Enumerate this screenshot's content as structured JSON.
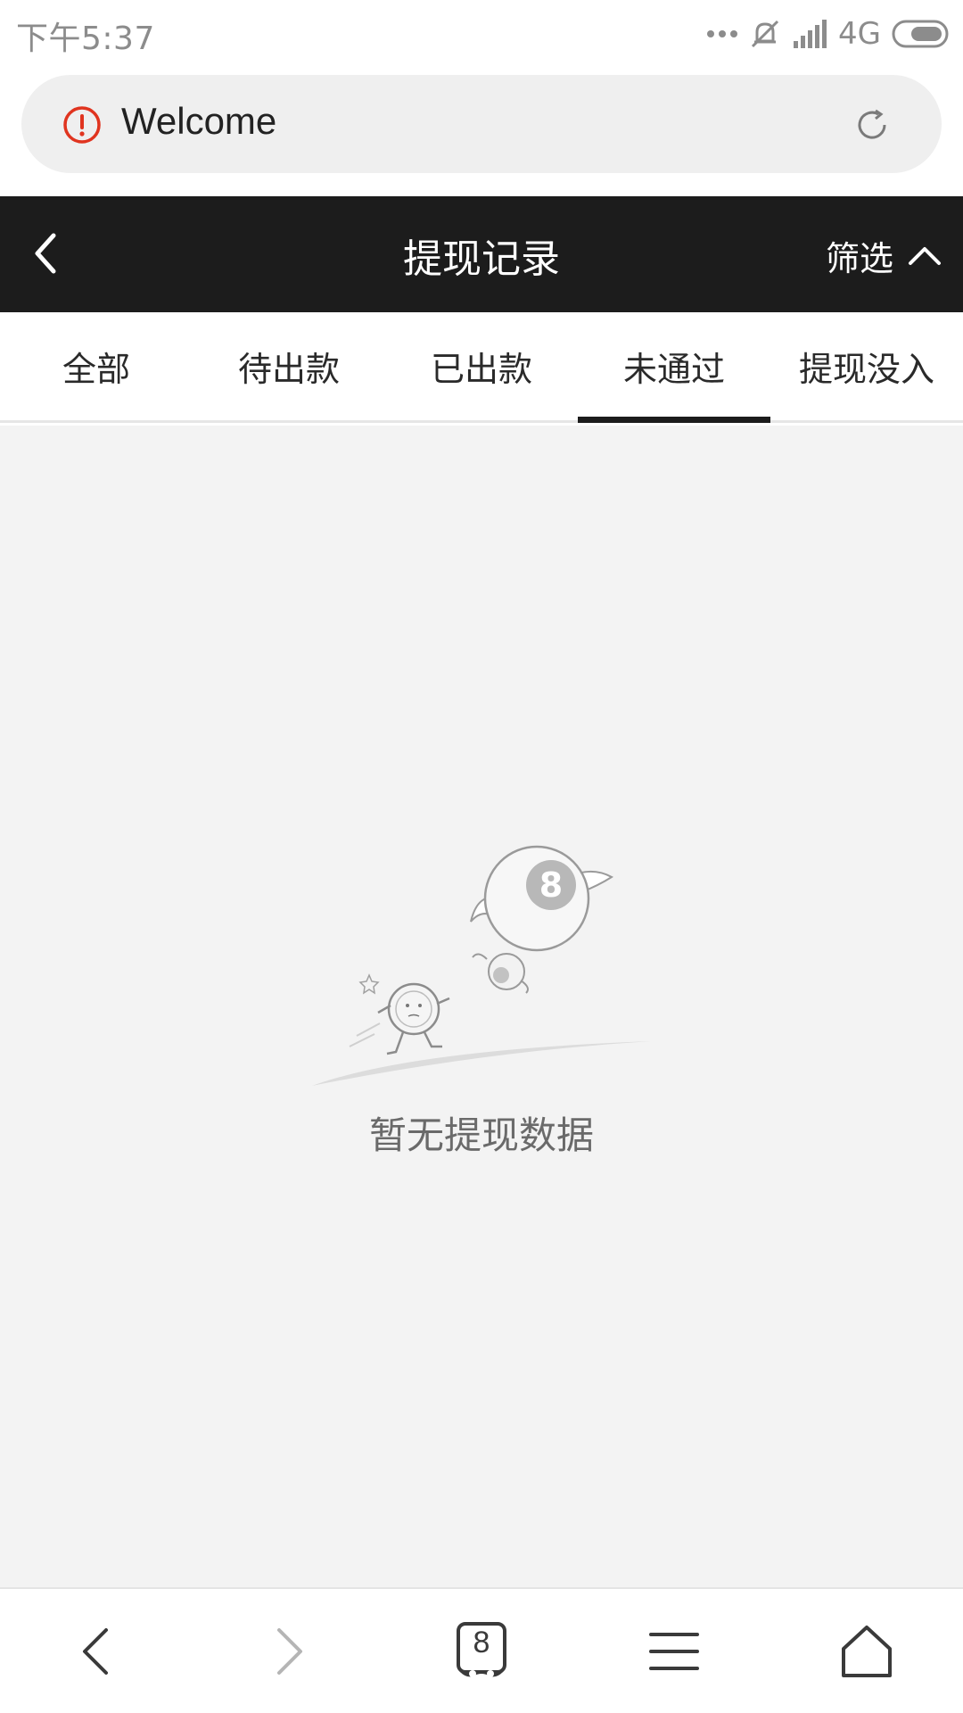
{
  "status_bar": {
    "time": "下午5:37",
    "network": "4G"
  },
  "browser": {
    "page_title": "Welcome",
    "icons": {
      "warning": "warning-circle-icon",
      "reload": "reload-icon"
    },
    "warning_color": "#e0341f"
  },
  "header": {
    "title": "提现记录",
    "filter_label": "筛选",
    "background": "#1c1c1c"
  },
  "tabs": [
    {
      "label": "全部",
      "active": false
    },
    {
      "label": "待出款",
      "active": false
    },
    {
      "label": "已出款",
      "active": false
    },
    {
      "label": "未通过",
      "active": true
    },
    {
      "label": "提现没入",
      "active": false
    }
  ],
  "empty_state": {
    "message": "暂无提现数据",
    "illustration": "running-coin-and-flying-8-ball"
  },
  "bottom_nav": {
    "tab_count": "8",
    "icons": [
      "back-icon",
      "forward-icon",
      "tabs-icon",
      "menu-icon",
      "home-icon"
    ]
  }
}
